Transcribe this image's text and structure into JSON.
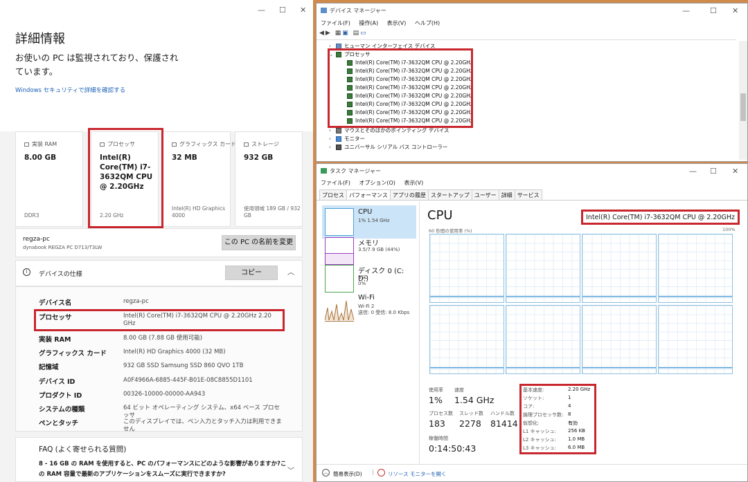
{
  "settings": {
    "title": "詳細情報",
    "subtitle_line1": "お使いの PC は監視されており、保護され",
    "subtitle_line2": "ています。",
    "security_link": "Windows セキュリティで詳細を確認する",
    "cards": [
      {
        "label": "実装 RAM",
        "value": "8.00 GB",
        "sub": "DDR3"
      },
      {
        "label": "プロセッサ",
        "value": "Intel(R) Core(TM) i7-3632QM CPU @ 2.20GHz",
        "sub": "2.20 GHz"
      },
      {
        "label": "グラフィックス カード",
        "value": "32 MB",
        "sub": "Intel(R) HD Graphics 4000"
      },
      {
        "label": "ストレージ",
        "value": "932 GB",
        "sub": "使用領域 189 GB / 932 GB"
      }
    ],
    "pc_name": "regza-pc",
    "pc_model": "dynabook REGZA PC D713/T3LW",
    "rename_button": "この PC の名前を変更",
    "device_spec_title": "デバイスの仕様",
    "copy_button": "コピー",
    "specs": [
      {
        "key": "デバイス名",
        "value": "regza-pc"
      },
      {
        "key": "プロセッサ",
        "value": "Intel(R) Core(TM) i7-3632QM CPU @ 2.20GHz 2.20 GHz"
      },
      {
        "key": "実装 RAM",
        "value": "8.00 GB (7.88 GB 使用可能)"
      },
      {
        "key": "グラフィックス カード",
        "value": "Intel(R) HD Graphics 4000 (32 MB)"
      },
      {
        "key": "記憶域",
        "value": "932 GB SSD Samsung SSD 860 QVO 1TB"
      },
      {
        "key": "デバイス ID",
        "value": "A0F4966A-6885-445F-B01E-08C8855D1101"
      },
      {
        "key": "プロダクト ID",
        "value": "00326-10000-00000-AA943"
      },
      {
        "key": "システムの種類",
        "value": "64 ビット オペレーティング システム、x64 ベース プロセッサ"
      },
      {
        "key": "ペンとタッチ",
        "value": "このディスプレイでは、ペン入力とタッチ入力は利用できません"
      }
    ],
    "faq_title": "FAQ (よく寄せられる質問)",
    "faq_q1": "8 - 16 GB の RAM を使用すると、PC のパフォーマンスにどのような影響がありますか?こ",
    "faq_q2": "の RAM 容量で最新のアプリケーションをスムーズに実行できますか?"
  },
  "devmgr": {
    "title": "デバイス マネージャー",
    "menu": [
      "ファイル(F)",
      "操作(A)",
      "表示(V)",
      "ヘルプ(H)"
    ],
    "hid": "ヒューマン インターフェイス デバイス",
    "processors_label": "プロセッサ",
    "cpus": [
      "Intel(R) Core(TM) i7-3632QM CPU @ 2.20GHz",
      "Intel(R) Core(TM) i7-3632QM CPU @ 2.20GHz",
      "Intel(R) Core(TM) i7-3632QM CPU @ 2.20GHz",
      "Intel(R) Core(TM) i7-3632QM CPU @ 2.20GHz",
      "Intel(R) Core(TM) i7-3632QM CPU @ 2.20GHz",
      "Intel(R) Core(TM) i7-3632QM CPU @ 2.20GHz",
      "Intel(R) Core(TM) i7-3632QM CPU @ 2.20GHz",
      "Intel(R) Core(TM) i7-3632QM CPU @ 2.20GHz"
    ],
    "mouse": "マウスとそのほかのポインティング デバイス",
    "monitor": "モニター",
    "usb": "ユニバーサル シリアル バス コントローラー"
  },
  "taskmgr": {
    "title": "タスク マネージャー",
    "menu": [
      "ファイル(F)",
      "オプション(O)",
      "表示(V)"
    ],
    "tabs": [
      "プロセス",
      "パフォーマンス",
      "アプリの履歴",
      "スタートアップ",
      "ユーザー",
      "詳細",
      "サービス"
    ],
    "side": [
      {
        "name": "CPU",
        "desc": "1% 1.54 GHz"
      },
      {
        "name": "メモリ",
        "desc": "3.5/7.9 GB (44%)"
      },
      {
        "name": "ディスク 0 (C: D:)",
        "desc": "SSD\n0%"
      },
      {
        "name": "Wi-Fi",
        "desc": "Wi-Fi 2\n送信: 0 受信: 8.0 Kbps"
      }
    ],
    "cpu_heading": "CPU",
    "cpu_name": "Intel(R) Core(TM) i7-3632QM CPU @ 2.20GHz",
    "graph_label": "60 秒間の使用率 (%)",
    "graph_max": "100%",
    "usage_label": "使用率",
    "usage": "1%",
    "speed_label": "速度",
    "speed": "1.54 GHz",
    "proc_label": "プロセス数",
    "proc": "183",
    "thread_label": "スレッド数",
    "thread": "2278",
    "handle_label": "ハンドル数",
    "handle": "81414",
    "uptime_label": "稼働時間",
    "uptime": "0:14:50:43",
    "info": [
      {
        "k": "基本速度:",
        "v": "2.20 GHz"
      },
      {
        "k": "ソケット:",
        "v": "1"
      },
      {
        "k": "コア:",
        "v": "4"
      },
      {
        "k": "論理プロセッサ数:",
        "v": "8"
      },
      {
        "k": "仮想化:",
        "v": "有効"
      },
      {
        "k": "L1 キャッシュ:",
        "v": "256 KB"
      },
      {
        "k": "L2 キャッシュ:",
        "v": "1.0 MB"
      },
      {
        "k": "L3 キャッシュ:",
        "v": "6.0 MB"
      }
    ],
    "footer_less": "簡易表示(D)",
    "footer_monitor": "リソース モニターを開く"
  }
}
